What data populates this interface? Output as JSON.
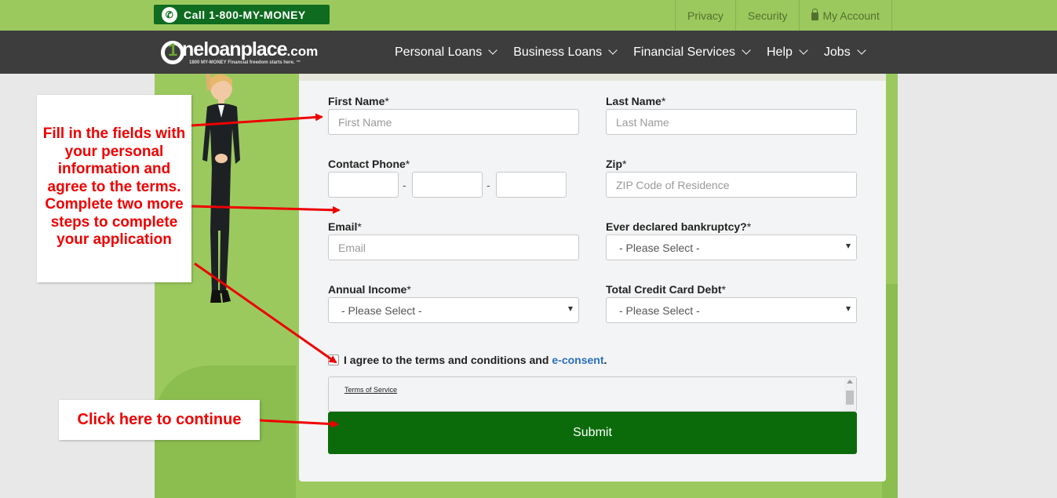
{
  "topbar": {
    "call_label": "Call 1-800-MY-MONEY",
    "links": [
      "Privacy",
      "Security",
      "My Account"
    ]
  },
  "nav": {
    "logo": {
      "one": "ne",
      "loan": "loanplace",
      "dotcom": ".com",
      "tagline": "1800 MY-MONEY Financial freedom starts here. ™"
    },
    "menu": [
      "Personal Loans",
      "Business Loans",
      "Financial Services",
      "Help",
      "Jobs"
    ]
  },
  "form": {
    "first_name": {
      "label": "First Name",
      "placeholder": "First Name"
    },
    "last_name": {
      "label": "Last Name",
      "placeholder": "Last Name"
    },
    "phone": {
      "label": "Contact Phone",
      "sep": "-"
    },
    "zip": {
      "label": "Zip",
      "placeholder": "ZIP Code of Residence"
    },
    "email": {
      "label": "Email",
      "placeholder": "Email"
    },
    "bankruptcy": {
      "label": "Ever declared bankruptcy?",
      "value": "- Please Select -"
    },
    "income": {
      "label": "Annual Income",
      "value": "- Please Select -"
    },
    "debt": {
      "label": "Total Credit Card Debt",
      "value": "- Please Select -"
    },
    "required_mark": "*",
    "agree_text": "I agree to the terms and conditions and",
    "agree_link": "e-consent",
    "agree_end": ".",
    "terms_link": "Terms of Service",
    "submit_label": "Submit"
  },
  "callouts": {
    "instructions": [
      "Fill in the fields with",
      "your personal",
      "information and",
      "agree to the terms.",
      "Complete two more",
      "steps to complete",
      "your application"
    ],
    "continue": "Click here to continue"
  },
  "colors": {
    "brand_green": "#9bc95e",
    "submit_green": "#0b6b0b",
    "nav_dark": "#3d3d3d",
    "callout_red": "#e00000",
    "link_blue": "#2a6ebb"
  }
}
